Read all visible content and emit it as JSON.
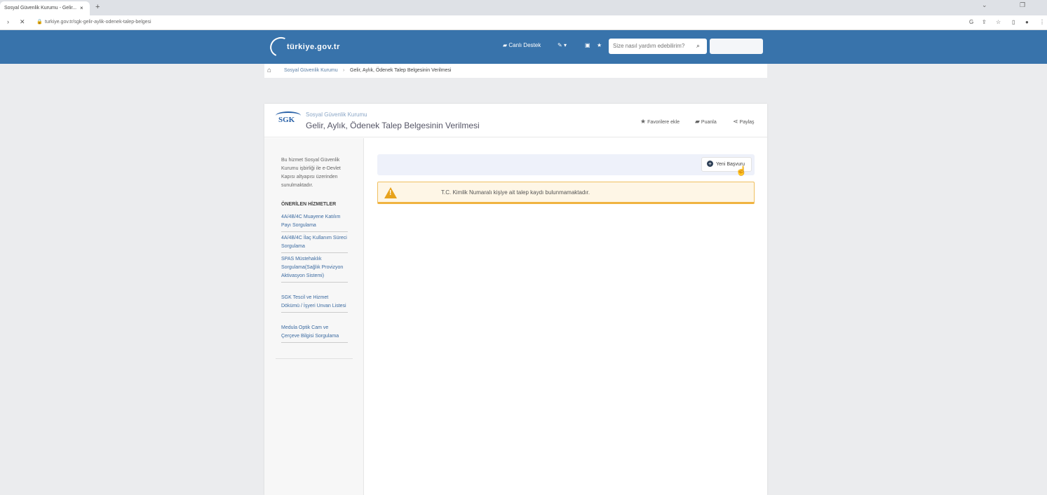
{
  "browser": {
    "tab_title": "Sosyal Güvenlik Kurumu - Gelir...",
    "tab_close": "×",
    "new_tab": "+",
    "url": "turkiye.gov.tr/sgk-gelir-aylik-odenek-talep-belgesi"
  },
  "header": {
    "logo_text": "türkiye.gov.tr",
    "live_support": "Canlı Destek",
    "search_placeholder": "Size nasıl yardım edebilirim?"
  },
  "breadcrumb": {
    "home_icon": "home-icon",
    "level1": "Sosyal Güvenlik Kurumu",
    "separator": "›",
    "level2": "Gelir, Aylık, Ödenek Talep Belgesinin Verilmesi"
  },
  "card": {
    "logo": "SGK",
    "org_name": "Sosyal Güvenlik Kurumu",
    "title": "Gelir, Aylık, Ödenek Talep Belgesinin Verilmesi",
    "actions": {
      "favorites": "Favorilere ekle",
      "rate": "Puanla",
      "share": "Paylaş"
    }
  },
  "sidebar": {
    "intro": "Bu hizmet Sosyal Güvenlik Kurumu işbirliği ile e-Devlet Kapısı altyapısı üzerinden sunulmaktadır.",
    "heading": "ÖNERİLEN HİZMETLER",
    "items": [
      {
        "label": "4A/4B/4C Muayene Katılım Payı Sorgulama"
      },
      {
        "label": "4A/4B/4C İlaç Kullanım Süreci Sorgulama"
      },
      {
        "label": "SPAS Müstehaklık Sorgulama(Sağlık Provizyon Aktivasyon Sistemi)"
      },
      {
        "label": "SGK Tescil ve Hizmet Dökümü / İşyeri Unvan Listesi"
      },
      {
        "label": "Medula Optik Cam ve Çerçeve Bilgisi Sorgulama"
      }
    ]
  },
  "main": {
    "new_application": "Yeni Başvuru",
    "new_application_icon": "+",
    "alert_icon": "!",
    "alert": "T.C. Kimlik Numaralı kişiye ait talep kaydı bulunmamaktadır."
  },
  "colors": {
    "header_bg": "#3873ab",
    "alert_bg": "#fef6e6",
    "alert_border": "#f0b340",
    "warning_icon": "#e7a21c",
    "link": "#3b6aa0"
  }
}
